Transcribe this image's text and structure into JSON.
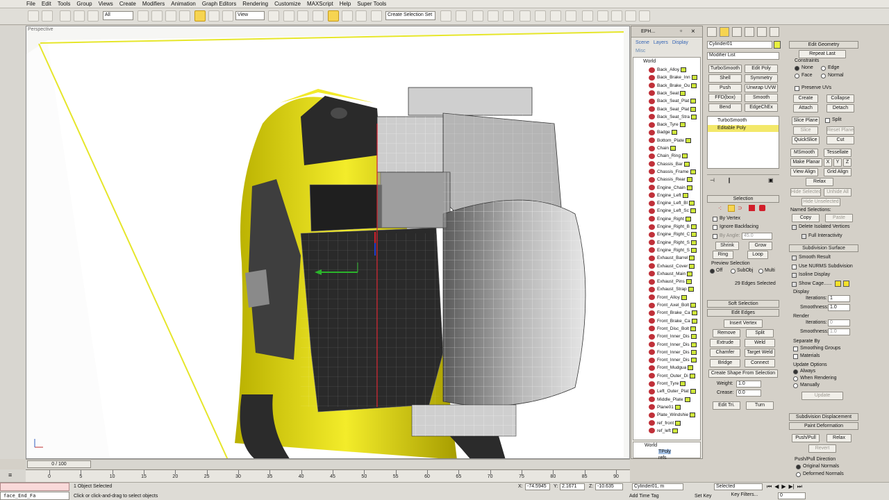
{
  "menu": [
    "File",
    "Edit",
    "Tools",
    "Group",
    "Views",
    "Create",
    "Modifiers",
    "Animation",
    "Graph Editors",
    "Rendering",
    "Customize",
    "MAXScript",
    "Help",
    "Super Tools"
  ],
  "toolbar": {
    "filter": "All",
    "ref_coord": "View",
    "named_sel": "Create Selection Set"
  },
  "viewport": {
    "label": "Perspective"
  },
  "scene_explorer": {
    "title": "EPH...",
    "tabs": [
      "Scene",
      "Layers",
      "Display"
    ],
    "misc": "Misc",
    "world": "World",
    "items": [
      "Back_Alloy",
      "Back_Brake_Inn",
      "Back_Brake_Ou",
      "Back_Seat",
      "Back_Seat_Plat",
      "Back_Seat_Plat",
      "Back_Seat_Stra",
      "Back_Tyre",
      "Badge",
      "Bottom_Plate",
      "Chain",
      "Chain_Ring",
      "Chassis_Bar",
      "Chassis_Frame",
      "Chassis_Rear",
      "Engine_Chain",
      "Engine_Left",
      "Engine_Left_Bl",
      "Engine_Left_Sc",
      "Engine_Right",
      "Engine_Right_B",
      "Engine_Right_C",
      "Engine_Right_S",
      "Engine_Right_S",
      "Exhaust_Barrel",
      "Exhaust_Cover",
      "Exhaust_Main",
      "Exhaust_Pins",
      "Exhaust_Strap",
      "Front_Alloy",
      "Front_Axel_Bolt",
      "Front_Brake_Ca",
      "Front_Brake_Ca",
      "Front_Disc_Bolt",
      "Front_Inner_Dis",
      "Front_Inner_Dis",
      "Front_Inner_Dis",
      "Front_Inner_Dis",
      "Front_Mudgua",
      "Front_Outer_Di",
      "Front_Tyre",
      "Left_Outer_Plat",
      "Middle_Plate",
      "Plane01",
      "Plate_Windshie",
      "ref_front",
      "ref_left"
    ],
    "world2": "World",
    "sub_items": [
      "TPoly",
      "refs"
    ]
  },
  "modify": {
    "object_name": "Cylinder01",
    "modifier_list": "Modifier List",
    "mod_buttons": [
      "TurboSmooth",
      "Edit Poly",
      "Shell",
      "Symmetry",
      "Push",
      "Unwrap UVW",
      "FFD(box)",
      "Smooth",
      "Bend",
      "EdgeChEx"
    ],
    "stack": [
      "TurboSmooth",
      "Editable Poly"
    ],
    "selection": {
      "header": "Selection",
      "by_vertex": "By Vertex",
      "ignore_backfacing": "Ignore Backfacing",
      "by_angle": "By Angle:",
      "angle_val": "45.0",
      "shrink": "Shrink",
      "grow": "Grow",
      "ring": "Ring",
      "loop": "Loop",
      "preview": "Preview Selection",
      "preview_opts": [
        "Off",
        "SubObj",
        "Multi"
      ],
      "status": "29 Edges Selected"
    },
    "soft_selection": "Soft Selection",
    "edit_edges": {
      "header": "Edit Edges",
      "insert_vertex": "Insert Vertex",
      "remove": "Remove",
      "split": "Split",
      "extrude": "Extrude",
      "weld": "Weld",
      "chamfer": "Chamfer",
      "target_weld": "Target Weld",
      "bridge": "Bridge",
      "connect": "Connect",
      "create_shape": "Create Shape From Selection",
      "weight_lbl": "Weight:",
      "weight_val": "1.0",
      "crease_lbl": "Crease:",
      "crease_val": "0.0",
      "edit_tri": "Edit Tri.",
      "turn": "Turn"
    }
  },
  "geometry": {
    "header": "Edit Geometry",
    "repeat_last": "Repeat Last",
    "constraints": "Constraints",
    "constraint_opts": [
      "None",
      "Edge",
      "Face",
      "Normal"
    ],
    "preserve_uvs": "Preserve UVs",
    "create": "Create",
    "collapse": "Collapse",
    "attach": "Attach",
    "detach": "Detach",
    "slice_plane": "Slice Plane",
    "split": "Split",
    "slice": "Slice",
    "reset_plane": "Reset Plane",
    "quickslice": "QuickSlice",
    "cut": "Cut",
    "msmooth": "MSmooth",
    "tessellate": "Tessellate",
    "make_planar": "Make Planar",
    "x": "X",
    "y": "Y",
    "z": "Z",
    "view_align": "View Align",
    "grid_align": "Grid Align",
    "relax": "Relax",
    "hide_selected": "Hide Selected",
    "unhide_all": "Unhide All",
    "hide_unselected": "Hide Unselected",
    "named_selections": "Named Selections:",
    "copy": "Copy",
    "paste": "Paste",
    "delete_isolated": "Delete Isolated Vertices",
    "full_interactivity": "Full Interactivity"
  },
  "subdivision": {
    "header": "Subdivision Surface",
    "smooth_result": "Smooth Result",
    "use_nurms": "Use NURMS Subdivision",
    "isoline": "Isoline Display",
    "show_cage": "Show Cage......",
    "display": "Display",
    "iterations_lbl": "Iterations:",
    "iterations_val": "1",
    "smoothness_lbl": "Smoothness:",
    "smoothness_val": "1.0",
    "render": "Render",
    "r_iterations_val": "0",
    "r_smoothness_val": "1.0",
    "separate_by": "Separate By",
    "smoothing_groups": "Smoothing Groups",
    "materials": "Materials",
    "update_options": "Update Options",
    "update_opts": [
      "Always",
      "When Rendering",
      "Manually"
    ],
    "update": "Update"
  },
  "subdiv_displacement": "Subdivision Displacement",
  "paint_deformation": {
    "header": "Paint Deformation",
    "push_pull": "Push/Pull",
    "relax": "Relax",
    "revert": "Revert",
    "direction": "Push/Pull Direction",
    "original_normals": "Original Normals",
    "deformed_normals": "Deformed Normals"
  },
  "timeline": {
    "frame": "0 / 100"
  },
  "ruler": [
    "0",
    "5",
    "10",
    "15",
    "20",
    "25",
    "30",
    "35",
    "40",
    "45",
    "50",
    "55",
    "60",
    "65",
    "70",
    "75",
    "80",
    "85",
    "90"
  ],
  "status": {
    "objects_selected": "1 Object Selected",
    "prompt": "Click or click-and-drag to select objects",
    "maxscript": "face_End_Fa",
    "x_lbl": "X:",
    "x_val": "-74.5945",
    "y_lbl": "Y:",
    "y_val": "2.1671",
    "z_lbl": "Z:",
    "z_val": "-10.635",
    "add_time_tag": "Add Time Tag",
    "set_key": "Set Key",
    "key_filters": "Key Filters...",
    "selected": "Selected",
    "frame_field": "0",
    "cyl_field": "Cylinder01, m"
  },
  "colors": {
    "accent": "#f6d451",
    "select_red": "#d21e2a",
    "stack_sel": "#f3e86a"
  }
}
